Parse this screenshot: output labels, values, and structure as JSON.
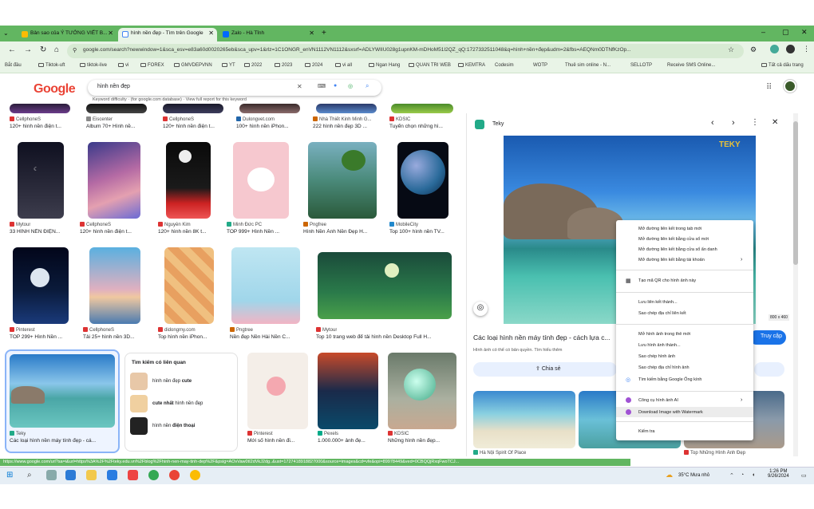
{
  "tabs": [
    {
      "label": "Bản sao của Ý TƯỞNG VIẾT B..."
    },
    {
      "label": "hình nền đẹp - Tìm trên Google"
    },
    {
      "label": "Zalo - Hà Tỉnh"
    }
  ],
  "window": {
    "minimize": "–",
    "maximize": "▢",
    "close": "✕"
  },
  "url": "google.com/search?newwindow=1&sca_esv=e83a60d0020265eb&sca_upv=1&rlz=1C1ONGR_enVN1112VN1112&sxsrf=ADLYWIIU028g1upnKM-mDHoM51I2QZ_qQ:1727332511048&q=hình+nền+đẹp&udm=2&fbs=AEQNm0DTNfKzOp...",
  "bookmarks": [
    "Bắt đầu",
    "Tiktok-uft",
    "tiktok-live",
    "vi",
    "FOREX",
    "GMVDEPVNN",
    "YT",
    "2022",
    "2023",
    "2024",
    "vi all",
    "Ngan Hang",
    "QUAN TRI WEB",
    "KEMTRA",
    "Codesim",
    "WOTP",
    "Thuê sim online - N...",
    "SELLOTP",
    "Receive SMS Online...",
    "Tất cả dấu trang"
  ],
  "search": {
    "logo": "Google",
    "query": "hình nền đẹp",
    "keyword_hint": "Keyword difficulty · (for google.com database) · View full report for this keyword"
  },
  "results": [
    {
      "source": "CellphoneS",
      "title": "120+ hình nền điện t..."
    },
    {
      "source": "Eiscenter",
      "title": "Album 70+ Hình nề..."
    },
    {
      "source": "CellphoneS",
      "title": "120+ hình nền điện t..."
    },
    {
      "source": "Dulongvet.com",
      "title": "100+ hình nền iPhon..."
    },
    {
      "source": "Nhà Thiết Kinh Minh G...",
      "title": "222 hình nền đẹp 3D ..."
    },
    {
      "source": "KDSIC",
      "title": "Tuyển chọn những hì..."
    },
    {
      "source": "Mytour",
      "title": "33 HÌNH NỀN ĐIỆN..."
    },
    {
      "source": "CellphoneS",
      "title": "120+ hình nền điện t..."
    },
    {
      "source": "Nguyễn Kim",
      "title": "120+ hình nền 8K t..."
    },
    {
      "source": "Minh Đức PC",
      "title": "TOP 999+ Hình Nền ..."
    },
    {
      "source": "Pngfree",
      "title": "Hình Nền Ảnh Nền Đẹp H..."
    },
    {
      "source": "MobileCity",
      "title": "Top 100+ hình nền TV..."
    },
    {
      "source": "Pinterest",
      "title": "TOP 299+ Hình Nền ..."
    },
    {
      "source": "CellphoneS",
      "title": "Tải 25+ hình nền 3D..."
    },
    {
      "source": "didongmy.com",
      "title": "Top hình nền iPhon..."
    },
    {
      "source": "Pngtree",
      "title": "Nền đẹp Nền Hài Nền C..."
    },
    {
      "source": "Mytour",
      "title": "Top 10 trang web để tải hình nền Desktop Full H..."
    },
    {
      "source": "Teky",
      "title": "Các loại hình nền máy tính đẹp - cá..."
    },
    {
      "source": "Pinterest",
      "title": "Mới số hình nền đi..."
    },
    {
      "source": "Pexels",
      "title": "1.000.000+ ảnh đẹ..."
    },
    {
      "source": "KDSIC",
      "title": "Những hình nền đẹp..."
    }
  ],
  "related": {
    "title": "Tìm kiếm có liên quan",
    "items": [
      {
        "pre": "hình nền đẹp ",
        "bold": "cute"
      },
      {
        "pre": "",
        "bold": "cute nhất",
        "post": " hình nền đẹp"
      },
      {
        "pre": "hình nền ",
        "bold": "điện thoại"
      }
    ]
  },
  "panel": {
    "source": "Teky",
    "watermark": "TEKY",
    "dims": "800 x 460",
    "title": "Các loại hình nền máy tính đẹp - cách lựa c...",
    "subtitle": "Hình ảnh có thể có bản quyền. Tìm hiểu thêm",
    "share": "Chia sẻ",
    "visit": "Truy cập",
    "bottom_left": "Hà Nội Spirit Of Place",
    "bottom_right": "Top Những Hình Ảnh Đẹp"
  },
  "context_menu": [
    "Mở đường liên kết trong tab mới",
    "Mở đường liên kết bằng cửa sổ mới",
    "Mở đường liên kết bằng cửa sổ ẩn danh",
    "Mở đường liên kết bằng tài khoản",
    "Tạo mã QR cho hình ảnh này",
    "Lưu liên kết thành...",
    "Sao chép địa chỉ liên kết",
    "Mở hình ảnh trong thẻ mới",
    "Lưu hình ảnh thành...",
    "Sao chép hình ảnh",
    "Sao chép địa chỉ hình ảnh",
    "Tìm kiếm bằng Google Ống kính",
    "Công cụ hình ảnh AI",
    "Download Image with Watermark",
    "Kiểm tra"
  ],
  "status_url": "https://www.google.com/url?sa=i&url=https%3A%2F%2Fteky.edu.vn%2Fblog%2Fhinh-nen-may-tinh-dep%2F&psig=AOvVaw0tI2dVkJ2dg..&ust=1727418918827000&source=images&cd=vfe&opi=89978449&ved=0CBQQjRxqFwoTCJ...",
  "taskbar": {
    "weather": "35°C Mưa nhỏ",
    "time": "1:26 PM",
    "date": "9/26/2024"
  }
}
